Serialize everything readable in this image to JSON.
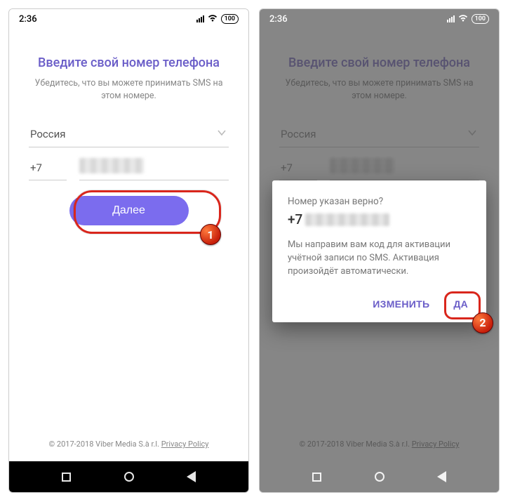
{
  "status": {
    "time": "2:36",
    "battery": "100"
  },
  "screen": {
    "heading": "Введите свой номер телефона",
    "subheading": "Убедитесь, что вы можете принимать SMS на этом номере.",
    "country": "Россия",
    "prefix": "+7",
    "next_label": "Далее"
  },
  "dialog": {
    "question": "Номер указан верно?",
    "number_prefix": "+7",
    "body": "Мы направим вам код для активации учётной записи по SMS. Активация произойдёт автоматически.",
    "edit_label": "ИЗМЕНИТЬ",
    "yes_label": "ДА"
  },
  "footer": {
    "copyright": "© 2017-2018 Viber Media S.à r.l. ",
    "privacy": "Privacy Policy"
  },
  "callouts": {
    "one": "1",
    "two": "2"
  }
}
